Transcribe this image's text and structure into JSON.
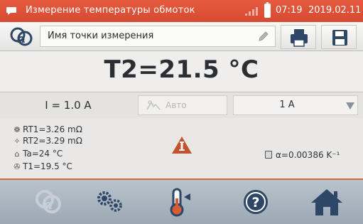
{
  "status_bar": {
    "title": "Измерение температуры обмоток",
    "time": "07:19",
    "date": "2019.02.11"
  },
  "header": {
    "measurement_point_name": "Имя точки измерения"
  },
  "main": {
    "temperature_result": "T2=21.5 °C"
  },
  "controls": {
    "current_label": "I = 1.0 A",
    "auto_label": "Авто",
    "range_value": "1 A"
  },
  "readings": {
    "rt1": "RT1=3.26 mΩ",
    "rt2": "RT2=3.29 mΩ",
    "ta": "Ta=24 °C",
    "t1": "T1=19.5 °C",
    "alpha": "α=0.00386 K⁻¹"
  },
  "icons": {
    "status": [
      "app-icon",
      "signal-icon",
      "battery-icon"
    ],
    "header": [
      "measurement-mode-icon",
      "edit-icon",
      "print-icon",
      "save-icon"
    ],
    "readings": [
      "resistance-icon",
      "temperature-icon",
      "coefficient-icon",
      "warning-icon"
    ],
    "nav": [
      "measurement-icon",
      "settings-icon",
      "thermometer-icon",
      "help-icon",
      "home-icon"
    ]
  },
  "colors": {
    "status_bar": "#d64a31",
    "accent": "#d95b34",
    "navy": "#2f4766",
    "nav_bar": "#a8b4bf"
  }
}
